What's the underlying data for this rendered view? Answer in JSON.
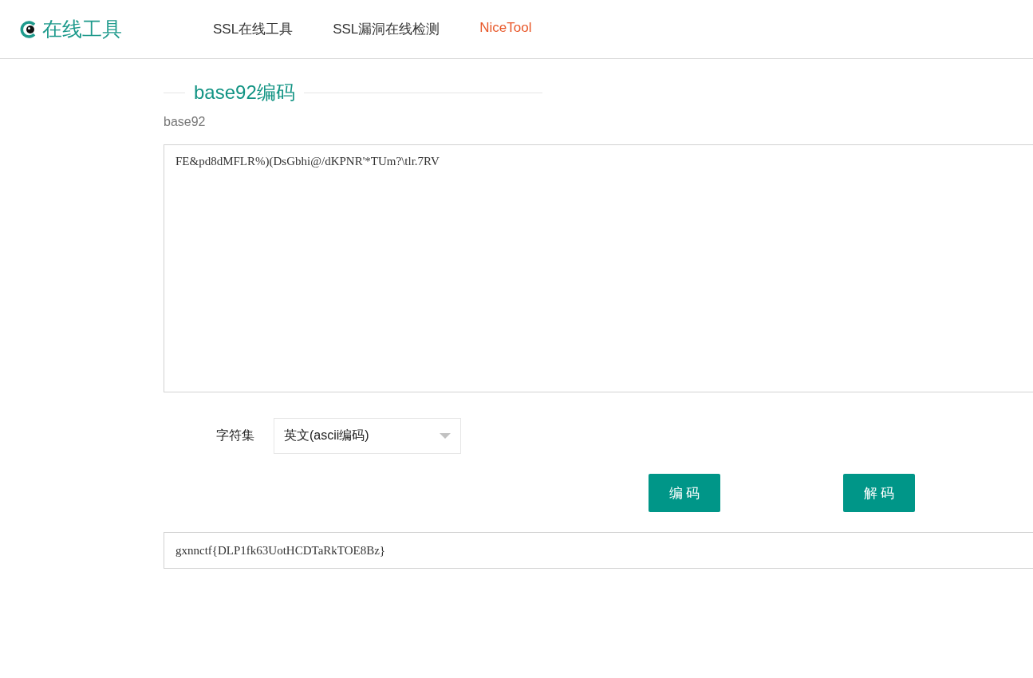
{
  "header": {
    "logo": "在线工具",
    "nav": [
      {
        "label": "SSL在线工具",
        "color": "#333333"
      },
      {
        "label": "SSL漏洞在线检测",
        "color": "#333333"
      },
      {
        "label": "NiceTool",
        "color": "#e8582a"
      }
    ]
  },
  "section": {
    "title": "base92编码",
    "label": "base92",
    "input": {
      "value": "FE&pd8dMFLR%)(DsGbhi@/dKPNR'*TUm?\\tlr.7RV"
    },
    "charset": {
      "label": "字符集",
      "value": "英文(ascii编码)"
    },
    "buttons": [
      "编 码",
      "解 码"
    ],
    "output": {
      "value": "gxnnctf{DLP1fk63UotHCDTaRkTOE8Bz}"
    }
  }
}
